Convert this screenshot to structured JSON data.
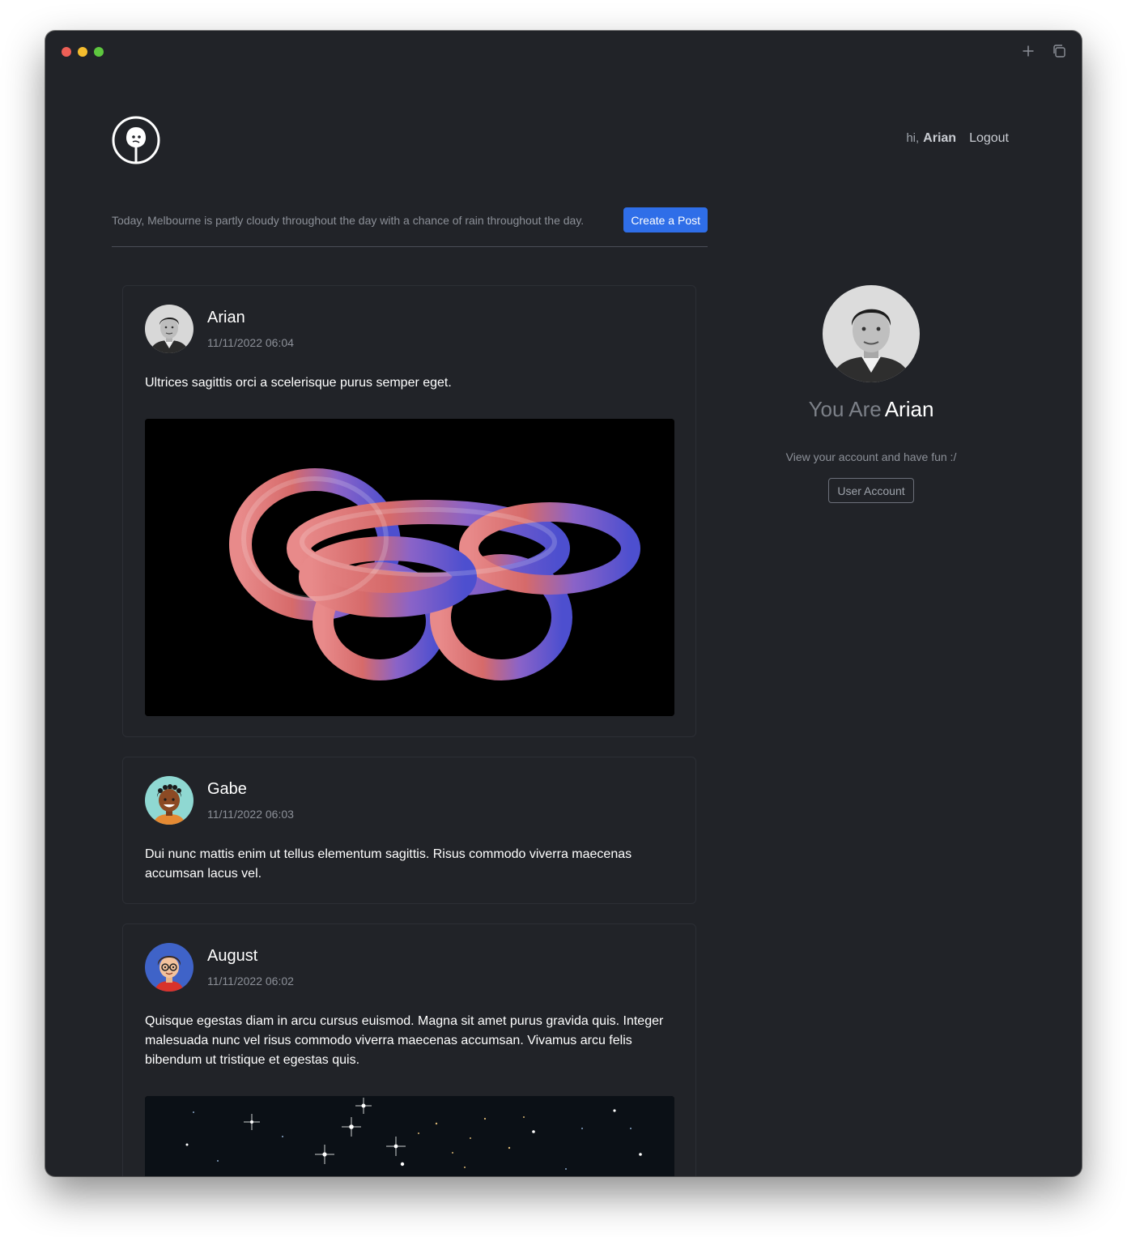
{
  "header": {
    "greeting": "hi,",
    "username": "Arian",
    "logout_label": "Logout"
  },
  "topbar": {
    "weather_text": "Today, Melbourne is partly cloudy throughout the day with a chance of rain throughout the day.",
    "create_post_label": "Create a Post"
  },
  "posts": [
    {
      "author": "Arian",
      "date": "11/11/2022 06:04",
      "text": "Ultrices sagittis orci a scelerisque purus semper eget."
    },
    {
      "author": "Gabe",
      "date": "11/11/2022 06:03",
      "text": "Dui nunc mattis enim ut tellus elementum sagittis. Risus commodo viverra maecenas accumsan lacus vel."
    },
    {
      "author": "August",
      "date": "11/11/2022 06:02",
      "text": "Quisque egestas diam in arcu cursus euismod. Magna sit amet purus gravida quis. Integer malesuada nunc vel risus commodo viverra maecenas accumsan. Vivamus arcu felis bibendum ut tristique et egestas quis."
    }
  ],
  "profile": {
    "prefix": "You Are",
    "name": "Arian",
    "subtitle": "View your account and have fun :/",
    "account_button_label": "User Account"
  },
  "icons": {
    "window_new_tab": "plus-icon",
    "window_tabs": "copy-icon",
    "logo": "app-logo-icon"
  },
  "colors": {
    "background": "#212328",
    "accent": "#2f6ee8",
    "muted_text": "#8c9098"
  }
}
